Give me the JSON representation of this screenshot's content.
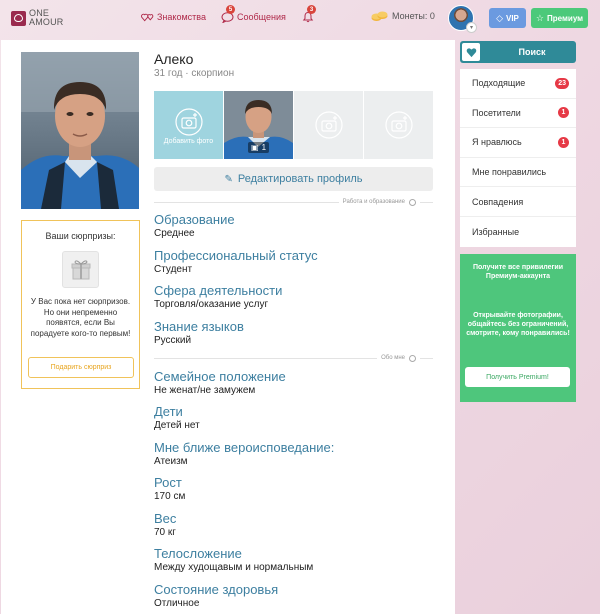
{
  "header": {
    "logo": {
      "line1": "ONE",
      "line2": "AMOUR"
    },
    "nav": [
      {
        "label": "Знакомства"
      },
      {
        "label": "Сообщения",
        "badge": "5"
      },
      {
        "label": "",
        "badge": "3"
      }
    ],
    "coins_label": "Монеты: 0",
    "vip_label": "VIP",
    "premium_label": "Премиум"
  },
  "profile": {
    "name": "Алеко",
    "age_sign": "31 год · скорпион",
    "add_photo_label": "Добавить фото",
    "photo_count": "1",
    "edit_label": "Редактировать профиль"
  },
  "surprises": {
    "title": "Ваши сюрпризы:",
    "text": "У Вас пока нет сюрпризов. Но они непременно появятся, если Вы порадуете кого-то первым!",
    "button": "Подарить сюрприз"
  },
  "sections": {
    "work_education": "Работа и образование",
    "about_me": "Обо мне"
  },
  "fields": {
    "education": {
      "label": "Образование",
      "value": "Среднее"
    },
    "prof_status": {
      "label": "Профессиональный статус",
      "value": "Студент"
    },
    "sphere": {
      "label": "Сфера деятельности",
      "value": "Торговля/оказание услуг"
    },
    "languages": {
      "label": "Знание языков",
      "value": "Русский"
    },
    "marital": {
      "label": "Семейное положение",
      "value": "Не женат/не замужем"
    },
    "children": {
      "label": "Дети",
      "value": "Детей нет"
    },
    "religion": {
      "label": "Мне ближе вероисповедание:",
      "value": "Атеизм"
    },
    "height": {
      "label": "Рост",
      "value": "170 см"
    },
    "weight": {
      "label": "Вес",
      "value": "70 кг"
    },
    "build": {
      "label": "Телосложение",
      "value": "Между худощавым и нормальным"
    },
    "health": {
      "label": "Состояние здоровья",
      "value": "Отличное"
    }
  },
  "sidebar": {
    "search_label": "Поиск",
    "menu": [
      {
        "label": "Подходящие",
        "badge": "23"
      },
      {
        "label": "Посетители",
        "badge": "1"
      },
      {
        "label": "Я нравлюсь",
        "badge": "1"
      },
      {
        "label": "Мне понравились",
        "badge": ""
      },
      {
        "label": "Совпадения",
        "badge": ""
      },
      {
        "label": "Избранные",
        "badge": ""
      }
    ],
    "promo": {
      "title": "Получите все привилегии Премиум-аккаунта",
      "text": "Открывайте фотографии, общайтесь без ограничений, смотрите, кому понравились!",
      "button": "Получить Premium!"
    }
  },
  "colors": {
    "accent": "#3d7fa0",
    "search": "#2f8a98",
    "premium": "#4ec67c",
    "vip": "#6b9ae0",
    "badge": "#e63946",
    "brand": "#9a2a4e"
  }
}
